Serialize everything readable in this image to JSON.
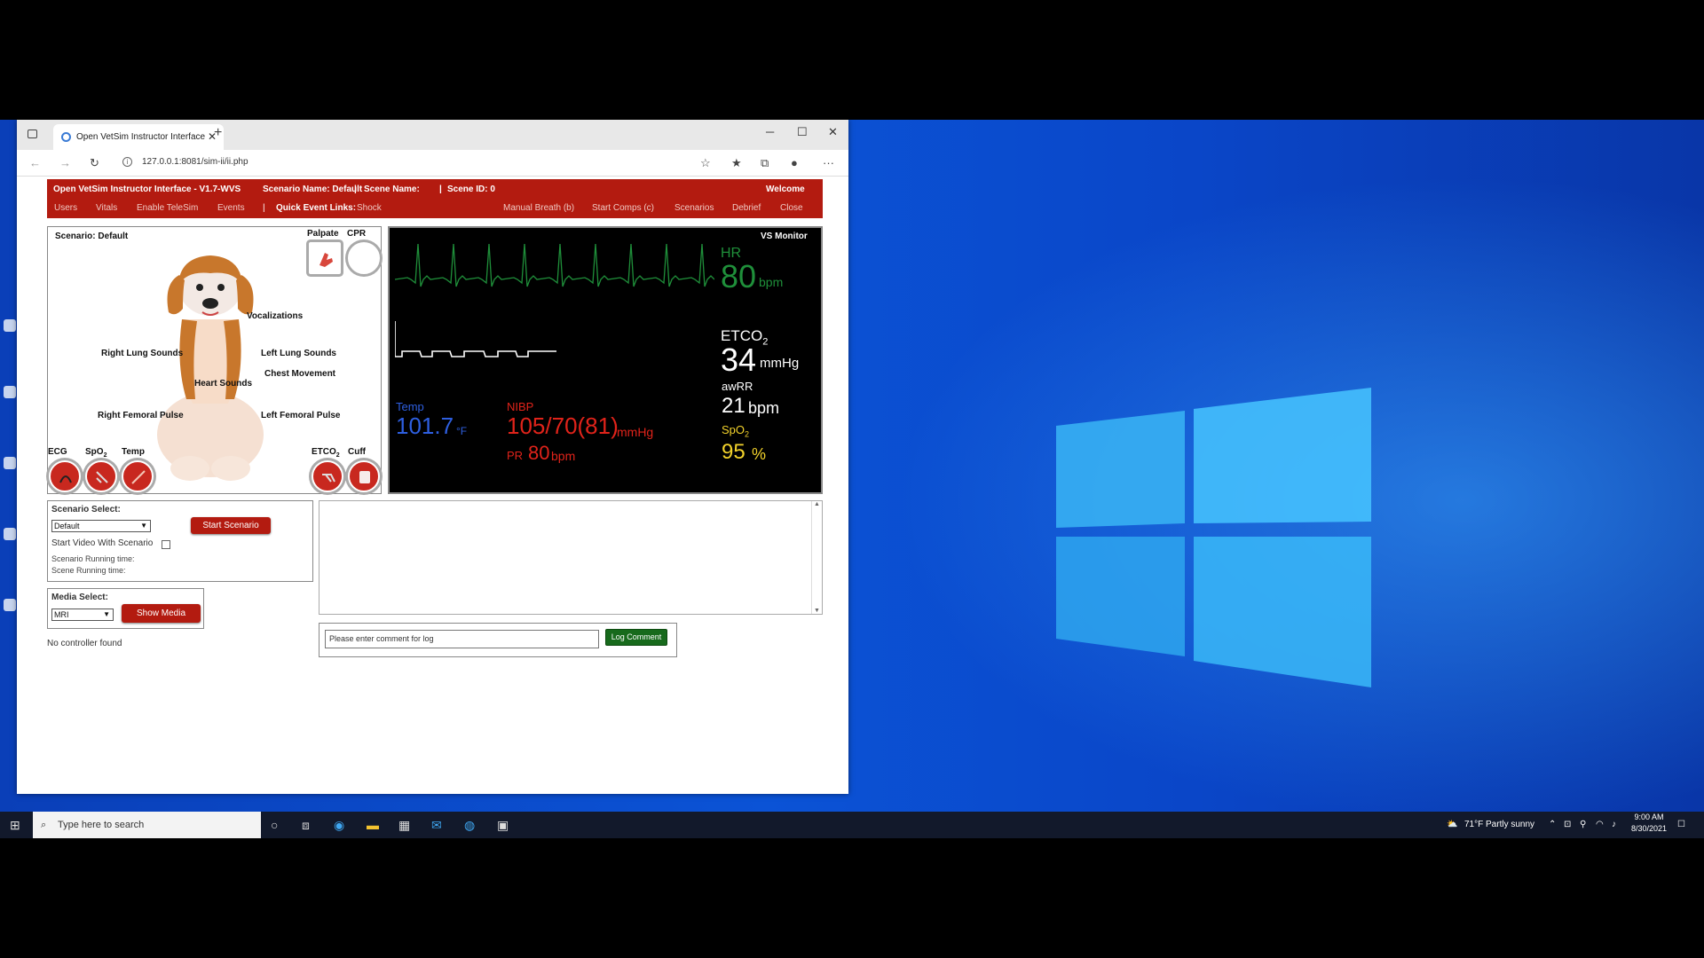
{
  "browser": {
    "tab_title": "Open VetSim Instructor Interface",
    "url": "127.0.0.1:8081/sim-ii/ii.php"
  },
  "header": {
    "app_title": "Open VetSim Instructor Interface - V1.7-WVS",
    "scenario_name": "Scenario Name: Default",
    "scene_name": "Scene Name:",
    "scene_id": "Scene ID: 0",
    "welcome": "Welcome",
    "sep1": "|",
    "sep2": "|",
    "nav_left": [
      "Users",
      "Vitals",
      "Enable TeleSim",
      "Events"
    ],
    "quick_label": "Quick Event Links:",
    "quick_link": "Shock",
    "nav_right": [
      "Manual Breath (b)",
      "Start Comps (c)",
      "Scenarios",
      "Debrief",
      "Close"
    ]
  },
  "patient": {
    "scenario": "Scenario: Default",
    "palpate": "Palpate",
    "cpr": "CPR",
    "vocalizations": "Vocalizations",
    "right_lung": "Right Lung Sounds",
    "left_lung": "Left Lung Sounds",
    "chest_movement": "Chest Movement",
    "heart_sounds": "Heart Sounds",
    "right_femoral": "Right Femoral Pulse",
    "left_femoral": "Left Femoral Pulse",
    "ecg": "ECG",
    "spo2_main": "SpO",
    "spo2_sub": "2",
    "temp": "Temp",
    "etco2_main": "ETCO",
    "etco2_sub": "2",
    "cuff": "Cuff"
  },
  "monitor": {
    "title": "VS Monitor",
    "hr_label": "HR",
    "hr_value": "80",
    "hr_unit": "bpm",
    "etco2_label": "ETCO",
    "etco2_sub": "2",
    "etco2_value": "34",
    "etco2_unit": "mmHg",
    "awrr_label": "awRR",
    "awrr_value": "21",
    "awrr_unit": "bpm",
    "spo2_label": "SpO",
    "spo2_sub": "2",
    "spo2_value": "95",
    "spo2_unit": "%",
    "temp_label": "Temp",
    "temp_value": "101.7",
    "temp_unit": "°F",
    "nibp_label": "NIBP",
    "nibp_value": "105/70(81)",
    "nibp_unit": "mmHg",
    "pr_label": "PR",
    "pr_value": "80",
    "pr_unit": "bpm",
    "colors": {
      "hr": "#1f8f3a",
      "temp": "#2e5fe0",
      "nibp": "#e0231a",
      "spo2": "#f2d22b",
      "text": "#ffffff"
    }
  },
  "scenario_panel": {
    "select_label": "Scenario Select:",
    "selected": "Default",
    "start_button": "Start Scenario",
    "video_label": "Start Video With Scenario",
    "scenario_time": "Scenario Running time:",
    "scene_time": "Scene Running time:"
  },
  "media_panel": {
    "select_label": "Media Select:",
    "selected": "MRI",
    "show_button": "Show Media"
  },
  "controller_status": "No controller found",
  "log": {
    "placeholder": "Please enter comment for log",
    "button": "Log Comment"
  },
  "taskbar": {
    "search_placeholder": "Type here to search",
    "weather": "71°F  Partly sunny",
    "time": "9:00 AM",
    "date": "8/30/2021"
  }
}
